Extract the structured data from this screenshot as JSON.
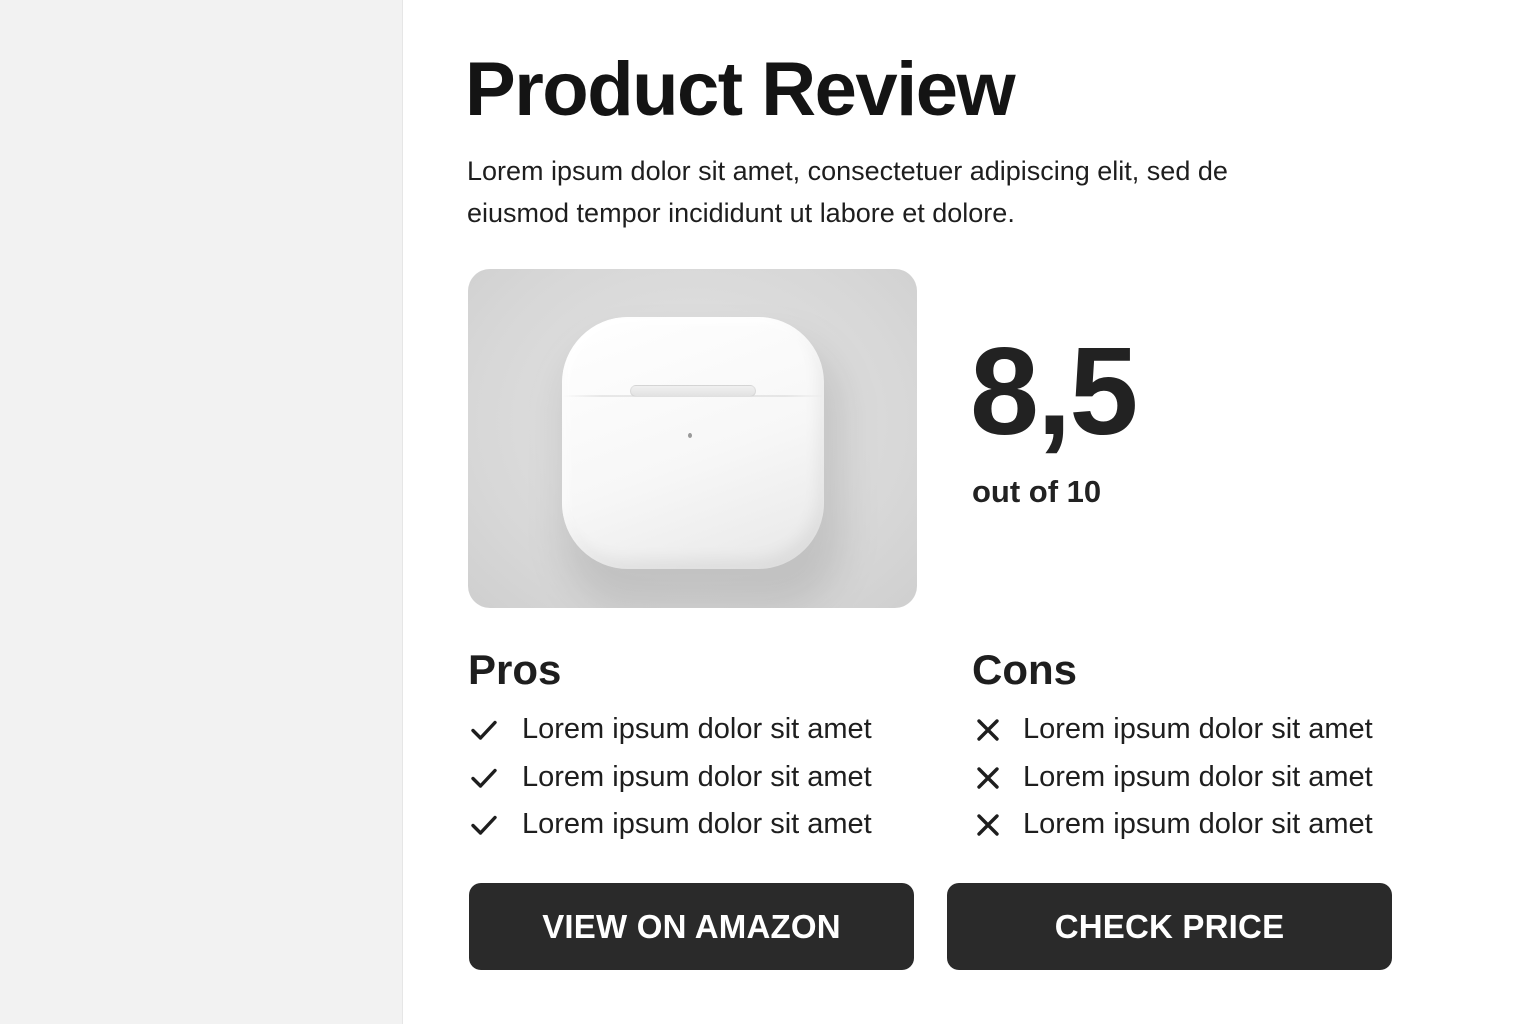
{
  "header": {
    "title": "Product Review",
    "intro": "Lorem ipsum dolor sit amet, consectetuer adipiscing elit, sed de eiusmod tempor incididunt ut labore et dolore."
  },
  "product": {
    "image_subject": "wireless earbuds charging case"
  },
  "rating": {
    "score": "8,5",
    "label": "out of 10"
  },
  "pros": {
    "title": "Pros",
    "icon": "check-icon",
    "items": [
      "Lorem ipsum dolor sit amet",
      "Lorem ipsum dolor sit amet",
      "Lorem ipsum dolor sit amet"
    ]
  },
  "cons": {
    "title": "Cons",
    "icon": "x-icon",
    "items": [
      "Lorem ipsum dolor sit amet",
      "Lorem ipsum dolor sit amet",
      "Lorem ipsum dolor sit amet"
    ]
  },
  "buttons": {
    "amazon_label": "VIEW ON AMAZON",
    "price_label": "CHECK PRICE"
  },
  "colors": {
    "button_bg": "#2a2a2a",
    "button_text": "#ffffff",
    "sidebar_bg": "#f2f2f2",
    "text": "#1e1e1e"
  }
}
